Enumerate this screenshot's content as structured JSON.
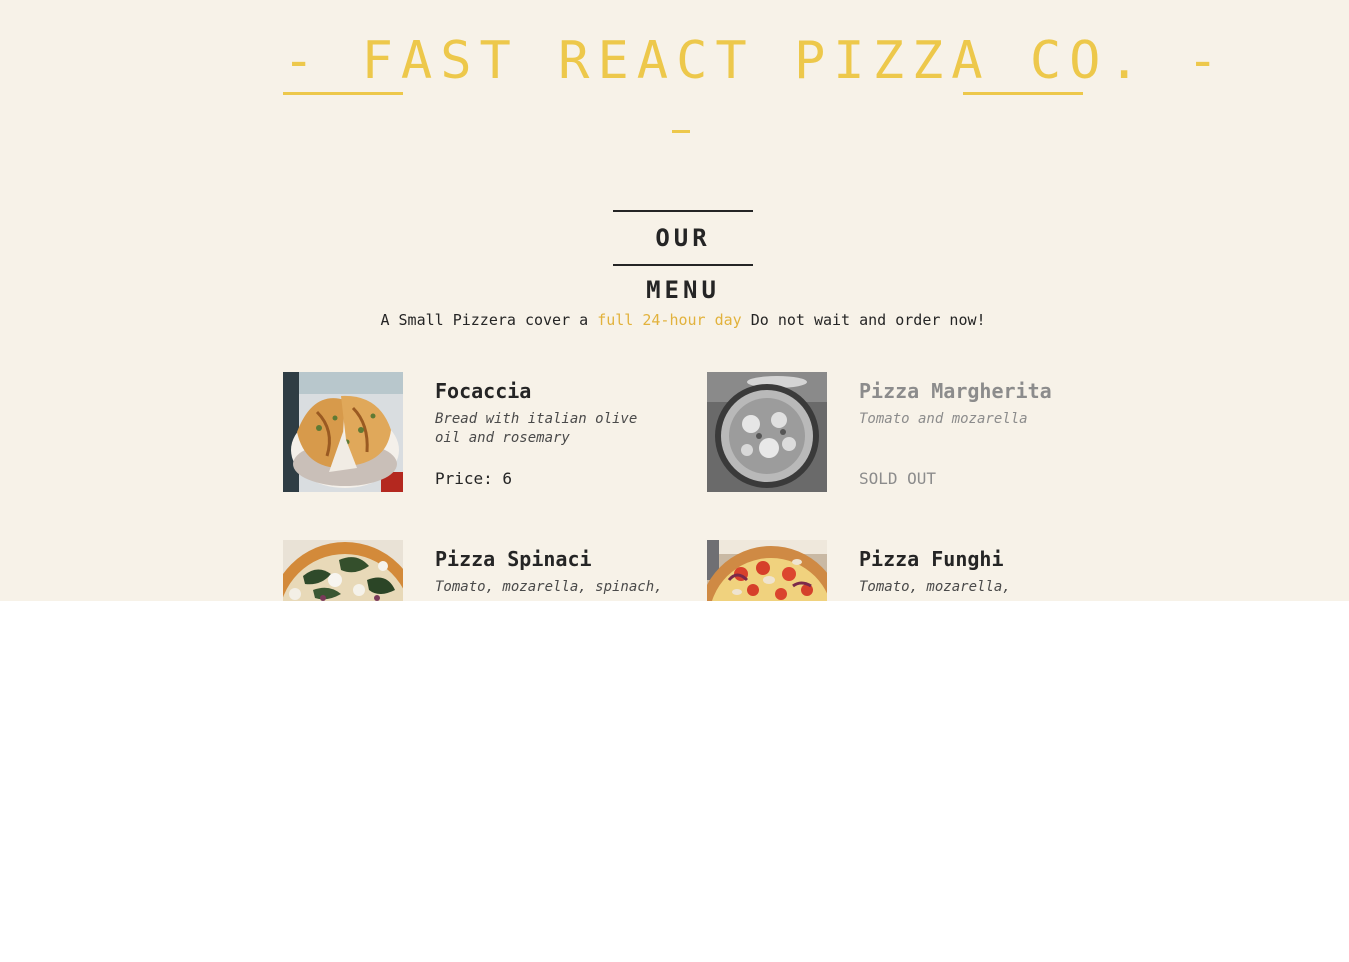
{
  "header": {
    "logo_text": "- FAST REACT PIZZA CO. -"
  },
  "menu": {
    "heading": "OUR MENU",
    "intro_before": "A Small Pizzera cover a ",
    "intro_highlight": "full 24-hour day",
    "intro_after": " Do not wait and order now!",
    "price_prefix": "Price: ",
    "pizzas": [
      {
        "name": "Focaccia",
        "ingredients": "Bread with italian olive oil and rosemary",
        "price": 6,
        "price_label": "Price: 6",
        "sold_out": false
      },
      {
        "name": "Pizza Margherita",
        "ingredients": "Tomato and mozarella",
        "price_label": "SOLD OUT",
        "sold_out": true
      },
      {
        "name": "Pizza Spinaci",
        "ingredients": "Tomato, mozarella, spinach,",
        "sold_out": false
      },
      {
        "name": "Pizza Funghi",
        "ingredients": "Tomato, mozarella,",
        "sold_out": false
      }
    ]
  },
  "colors": {
    "background": "#f7f2e8",
    "accent": "#edc84b",
    "text": "#252525",
    "sold_out_text": "#8c8c8c"
  }
}
